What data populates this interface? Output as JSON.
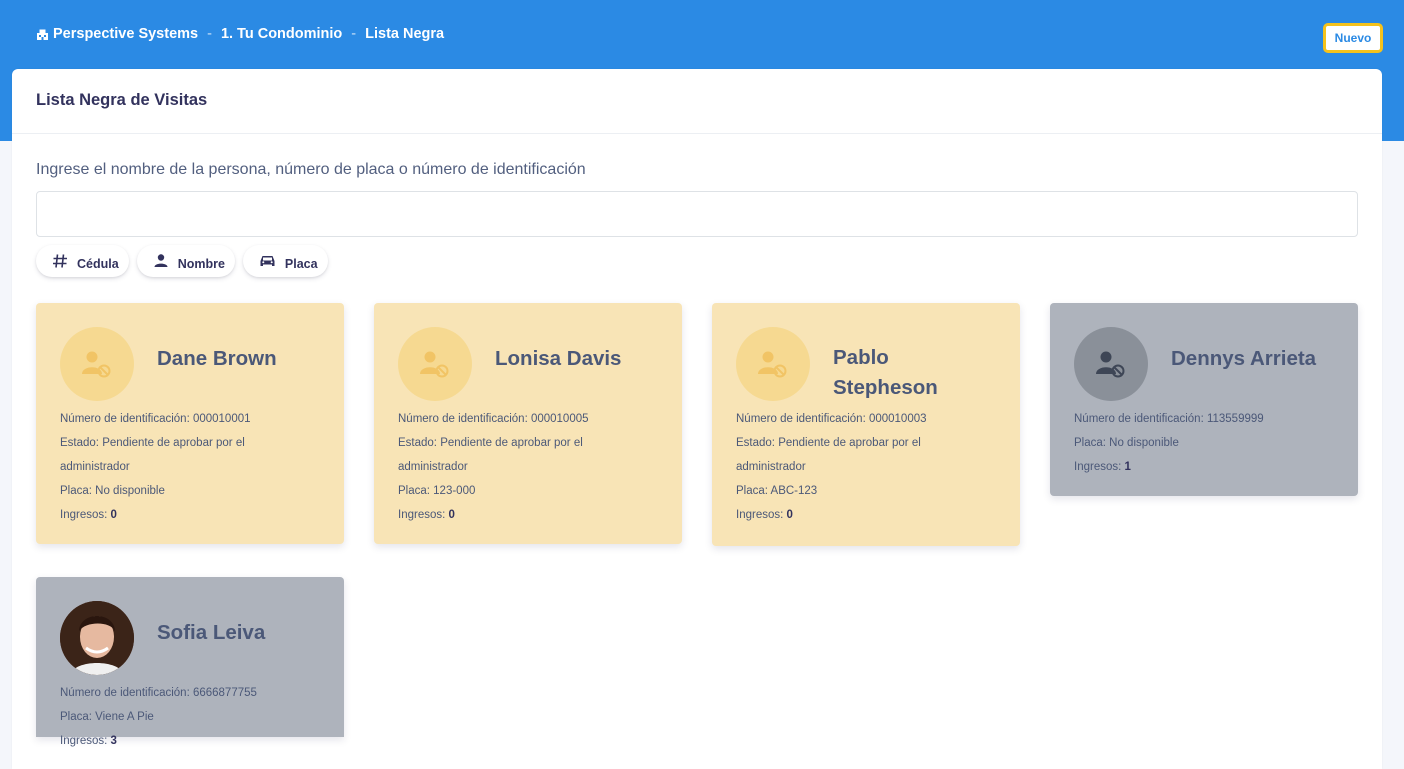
{
  "breadcrumb": {
    "app": "Perspective Systems",
    "condo": "1. Tu Condominio",
    "current": "Lista Negra",
    "separator": "-"
  },
  "header": {
    "new_button": "Nuevo"
  },
  "page_title": "Lista Negra de Visitas",
  "search": {
    "label": "Ingrese el nombre de la persona, número de placa o número de identificación",
    "value": "",
    "placeholder": ""
  },
  "filters": [
    {
      "label": "Cédula",
      "icon": "hash-icon"
    },
    {
      "label": "Nombre",
      "icon": "person-icon"
    },
    {
      "label": "Placa",
      "icon": "car-icon"
    }
  ],
  "cards": [
    {
      "name": "Dane Brown",
      "status": "pending",
      "id_label": "Número de identificación: 000010001",
      "estado_line1": "Estado: Pendiente de aprobar por el",
      "estado_line2": "administrador",
      "placa": "Placa: No disponible",
      "ingresos_label": "Ingresos:",
      "ingresos": "0"
    },
    {
      "name": "Lonisa Davis",
      "status": "pending",
      "id_label": "Número de identificación: 000010005",
      "estado_line1": "Estado: Pendiente de aprobar por el",
      "estado_line2": "administrador",
      "placa": "Placa: 123-000",
      "ingresos_label": "Ingresos:",
      "ingresos": "0"
    },
    {
      "name_line1": "Pablo",
      "name_line2": "Stepheson",
      "status": "pending",
      "id_label": "Número de identificación: 000010003",
      "estado_line1": "Estado: Pendiente de aprobar por el",
      "estado_line2": "administrador",
      "placa": "Placa: ABC-123",
      "ingresos_label": "Ingresos:",
      "ingresos": "0"
    },
    {
      "name": "Dennys Arrieta",
      "status": "blocked",
      "id_label": "Número de identificación: 113559999",
      "placa": "Placa: No disponible",
      "ingresos_label": "Ingresos:",
      "ingresos": "1"
    },
    {
      "name": "Sofia Leiva",
      "status": "blocked",
      "id_label": "Número de identificación: 6666877755",
      "placa": "Placa: Viene A Pie",
      "ingresos_label": "Ingresos:",
      "ingresos": "3"
    }
  ],
  "colors": {
    "header_blue": "#2b8ae4",
    "pending_card": "#f8e4b6",
    "blocked_card": "#aeb3bc",
    "new_button_border": "#f5c21b"
  }
}
